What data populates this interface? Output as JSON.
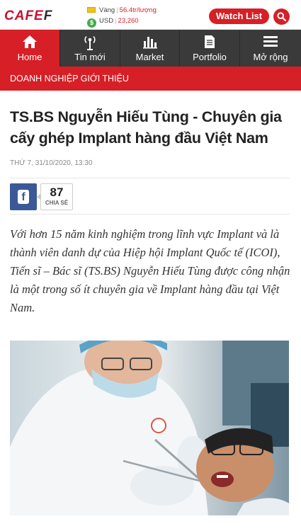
{
  "header": {
    "logo": {
      "part1": "CAFE",
      "part2": "F"
    },
    "gold": {
      "label": "Vàng",
      "value": "56.4tr/lượng"
    },
    "usd": {
      "label": "USD",
      "value": "23,260"
    },
    "watch_list_label": "Watch List"
  },
  "nav": {
    "items": [
      {
        "label": "Home",
        "icon": "home-icon",
        "active": true
      },
      {
        "label": "Tin mới",
        "icon": "broadcast-icon"
      },
      {
        "label": "Market",
        "icon": "bar-chart-icon"
      },
      {
        "label": "Portfolio",
        "icon": "document-icon"
      },
      {
        "label": "Mở rộng",
        "icon": "menu-icon"
      }
    ]
  },
  "section_label": "DOANH NGHIỆP GIỚI THIỆU",
  "article": {
    "title": "TS.BS Nguyễn Hiếu Tùng - Chuyên gia cấy ghép Implant hàng đầu Việt Nam",
    "date": "THỨ 7, 31/10/2020, 13:30",
    "share_count": "87",
    "share_label": "CHIA SẺ",
    "lead": "Với hơn 15 năm kinh nghiệm trong lĩnh vực Implant và là thành viên danh dự của Hiệp hội Implant Quốc tế (ICOI), Tiến sĩ – Bác sĩ (TS.BS) Nguyễn Hiếu Tùng được công nhận là một trong số ít chuyên gia về Implant hàng đầu tại Việt Nam."
  },
  "colors": {
    "brand_red": "#d61f26",
    "nav_dark": "#3a3a3a",
    "facebook_blue": "#3b5998"
  }
}
